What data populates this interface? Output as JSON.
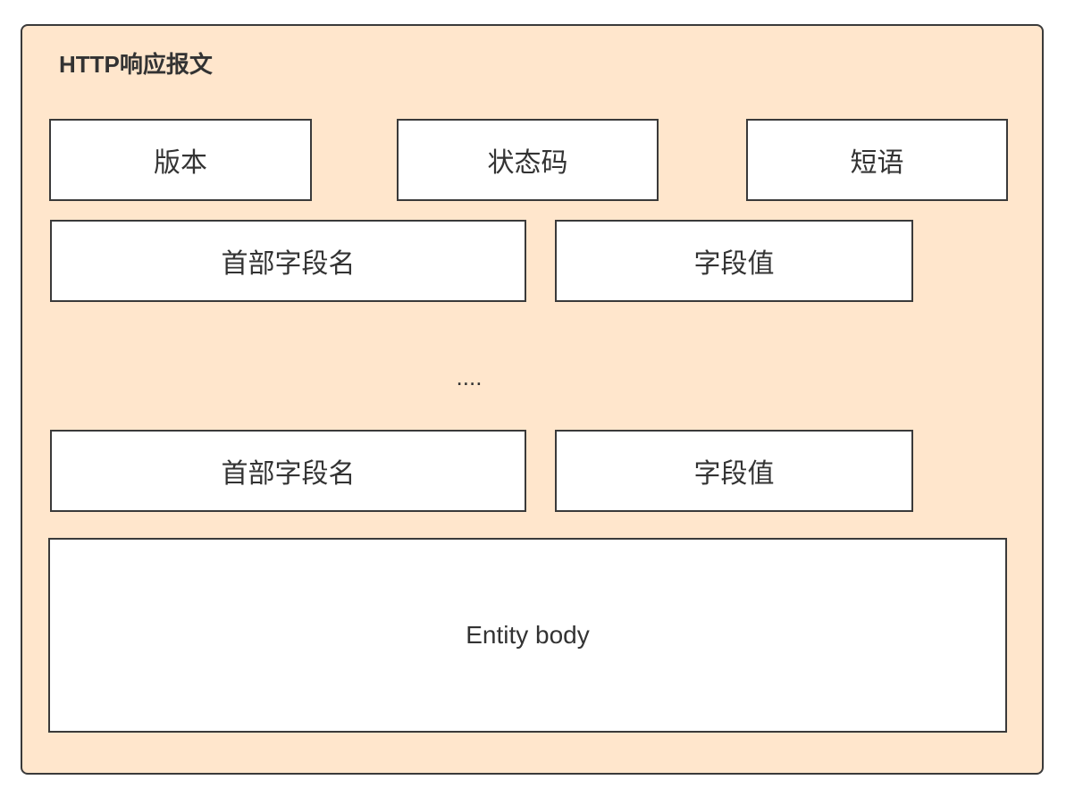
{
  "diagram": {
    "title": "HTTP响应报文",
    "status_line": {
      "version": "版本",
      "status_code": "状态码",
      "phrase": "短语"
    },
    "headers": [
      {
        "name": "首部字段名",
        "value": "字段值"
      },
      {
        "name": "首部字段名",
        "value": "字段值"
      }
    ],
    "ellipsis": "....",
    "entity_body": "Entity body"
  },
  "colors": {
    "container_fill": "#ffe6cc",
    "border": "#3a3a3a",
    "box_fill": "#ffffff",
    "text": "#333333"
  }
}
